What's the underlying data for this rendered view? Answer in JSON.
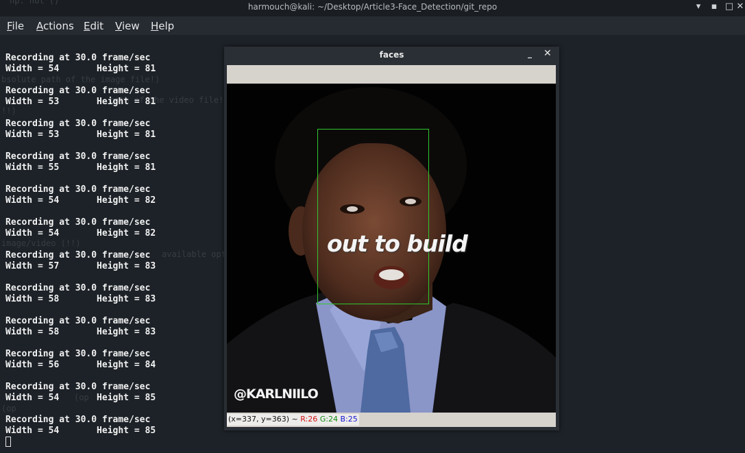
{
  "titlebar": {
    "title": "harmouch@kali: ~/Desktop/Article3-Face_Detection/git_repo",
    "ghost": "np. not ()"
  },
  "menu": [
    "File",
    "Actions",
    "Edit",
    "View",
    "Help"
  ],
  "terminal": {
    "lines": [
      "Recording at 30.0 frame/sec",
      "Width = 54       Height = 81",
      "Recording at 30.0 frame/sec",
      "Width = 53       Height = 81",
      "Recording at 30.0 frame/sec",
      "Width = 53       Height = 81",
      "Recording at 30.0 frame/sec",
      "Width = 55       Height = 81",
      "Recording at 30.0 frame/sec",
      "Width = 54       Height = 82",
      "Recording at 30.0 frame/sec",
      "Width = 54       Height = 82",
      "Recording at 30.0 frame/sec",
      "Width = 57       Height = 83",
      "Recording at 30.0 frame/sec",
      "Width = 58       Height = 83",
      "Recording at 30.0 frame/sec",
      "Width = 58       Height = 83",
      "Recording at 30.0 frame/sec",
      "Width = 56       Height = 84",
      "Recording at 30.0 frame/sec",
      "Width = 54       Height = 85",
      "Recording at 30.0 frame/sec",
      "Width = 54       Height = 85"
    ],
    "ghost": [
      "bsolute path of the image file!)",
      "path of the video file!",
      "!!)",
      "image/video (!!)",
      "available options",
      "(op",
      "(op"
    ]
  },
  "window": {
    "title": "faces",
    "minimize": "_",
    "close": "✕",
    "overlay_text": "out to build",
    "watermark": "@KARLNIILO",
    "status": {
      "coords": "(x=337, y=363) ~ ",
      "r": "R:26",
      "g": "G:24",
      "b": "B:25"
    },
    "colors": {
      "face_box": "#2ec82e",
      "r": "#d01010",
      "g": "#108a10",
      "b": "#1010d0"
    }
  }
}
